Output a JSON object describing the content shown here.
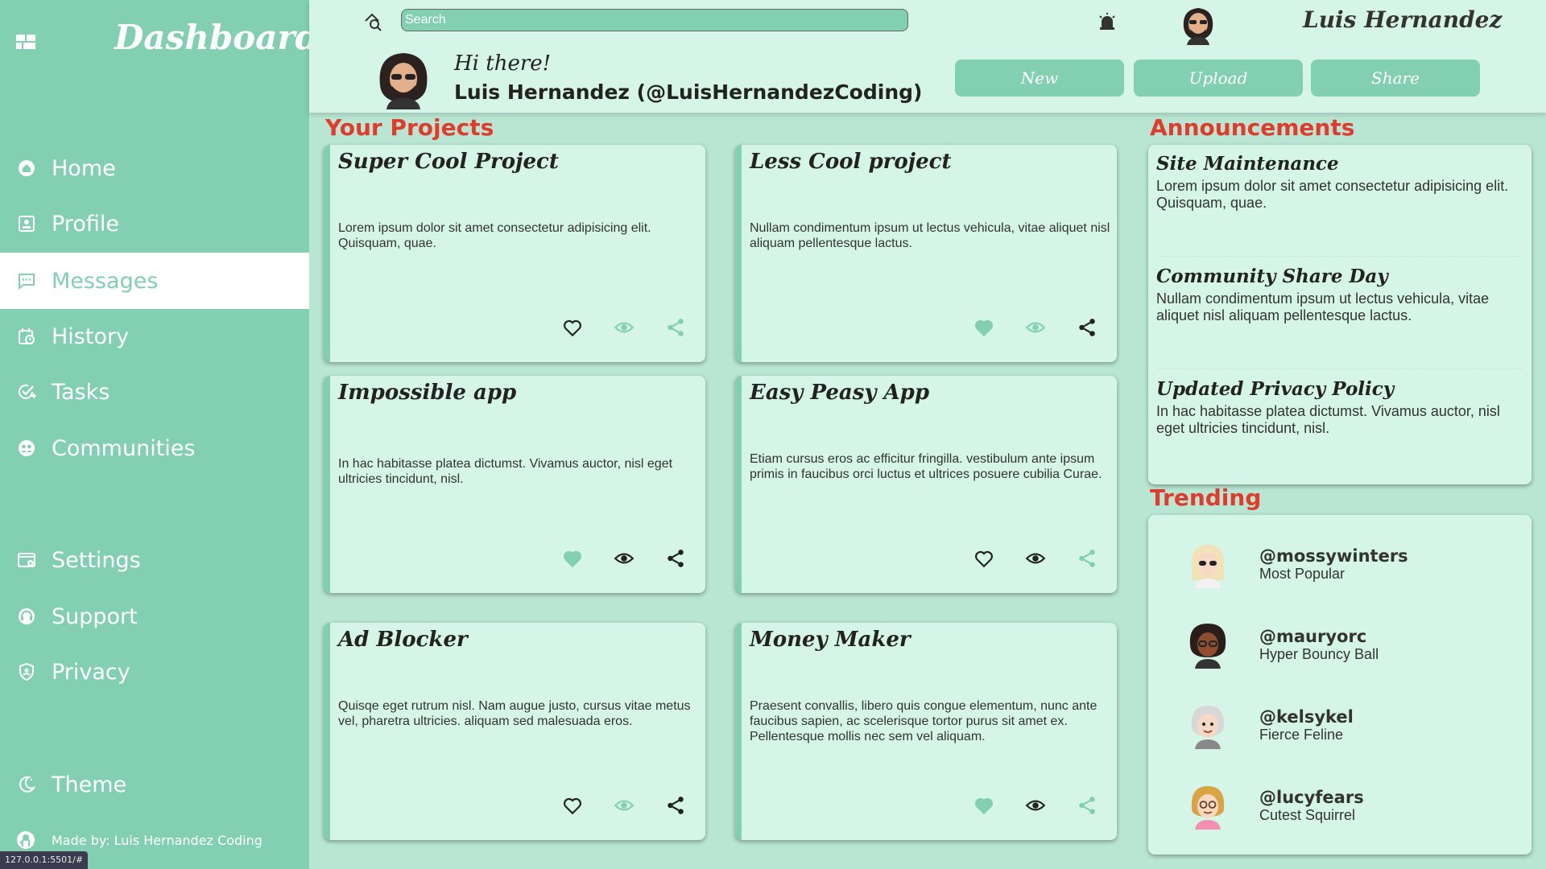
{
  "sidebar": {
    "title": "Dashboard",
    "nav": [
      {
        "label": "Home",
        "icon": "home-icon"
      },
      {
        "label": "Profile",
        "icon": "profile-icon"
      },
      {
        "label": "Messages",
        "icon": "message-icon",
        "active": true
      },
      {
        "label": "History",
        "icon": "history-icon"
      },
      {
        "label": "Tasks",
        "icon": "tasks-icon"
      },
      {
        "label": "Communities",
        "icon": "communities-icon"
      },
      {
        "label": "Settings",
        "icon": "settings-icon"
      },
      {
        "label": "Support",
        "icon": "support-icon"
      },
      {
        "label": "Privacy",
        "icon": "privacy-icon"
      },
      {
        "label": "Theme",
        "icon": "moon-icon"
      }
    ],
    "footer": "Made by: Luis Hernandez Coding"
  },
  "status_url": "127.0.0.1:5501/#",
  "header": {
    "search_placeholder": "Search",
    "user_name": "Luis Hernandez",
    "greeting": "Hi there!",
    "handle": "Luis Hernandez (@LuisHernandezCoding)",
    "buttons": {
      "new": "New",
      "upload": "Upload",
      "share": "Share"
    }
  },
  "projects": {
    "title": "Your Projects",
    "items": [
      {
        "title": "Super Cool Project",
        "desc": "Lorem ipsum dolor sit amet consectetur adipisicing elit. Quisquam, quae.",
        "liked": false,
        "watch_active": true,
        "share_active": true
      },
      {
        "title": "Less Cool project",
        "desc": "Nullam condimentum ipsum ut lectus vehicula, vitae aliquet nisl aliquam pellentesque lactus.",
        "liked": true,
        "watch_active": true,
        "share_active": false
      },
      {
        "title": "Impossible app",
        "desc": "In hac habitasse platea dictumst. Vivamus auctor, nisl eget ultricies tincidunt, nisl.",
        "liked": true,
        "watch_active": false,
        "share_active": false
      },
      {
        "title": "Easy Peasy App",
        "desc": "Etiam cursus eros ac efficitur fringilla. vestibulum ante ipsum primis in faucibus orci luctus et ultrices posuere cubilia Curae.",
        "liked": false,
        "watch_active": false,
        "share_active": true
      },
      {
        "title": "Ad Blocker",
        "desc": "Quisqe eget rutrum nisl. Nam augue justo, cursus vitae metus vel, pharetra ultricies. aliquam sed malesuada eros.",
        "liked": false,
        "watch_active": true,
        "share_active": false
      },
      {
        "title": "Money Maker",
        "desc": "Praesent convallis, libero quis congue elementum, nunc ante faucibus sapien, ac scelerisque tortor purus sit amet ex. Pellentesque mollis nec sem vel aliquam.",
        "liked": true,
        "watch_active": false,
        "share_active": true
      }
    ]
  },
  "announcements": {
    "title": "Announcements",
    "items": [
      {
        "title": "Site Maintenance",
        "text": "Lorem ipsum dolor sit amet consectetur adipisicing elit. Quisquam, quae."
      },
      {
        "title": "Community Share Day",
        "text": "Nullam condimentum ipsum ut lectus vehicula, vitae aliquet nisl aliquam pellentesque lactus."
      },
      {
        "title": "Updated Privacy Policy",
        "text": "In hac habitasse platea dictumst. Vivamus auctor, nisl eget ultricies tincidunt, nisl."
      }
    ]
  },
  "trending": {
    "title": "Trending",
    "items": [
      {
        "handle": "@mossywinters",
        "sub": "Most Popular"
      },
      {
        "handle": "@mauryorc",
        "sub": "Hyper Bouncy Ball"
      },
      {
        "handle": "@kelsykel",
        "sub": "Fierce Feline"
      },
      {
        "handle": "@lucyfears",
        "sub": "Cutest Squirrel"
      }
    ]
  },
  "colors": {
    "accent": "#82cfb2",
    "panel": "#d4f5e8",
    "background": "#b9e6d3",
    "section_title": "#e03c2d"
  }
}
